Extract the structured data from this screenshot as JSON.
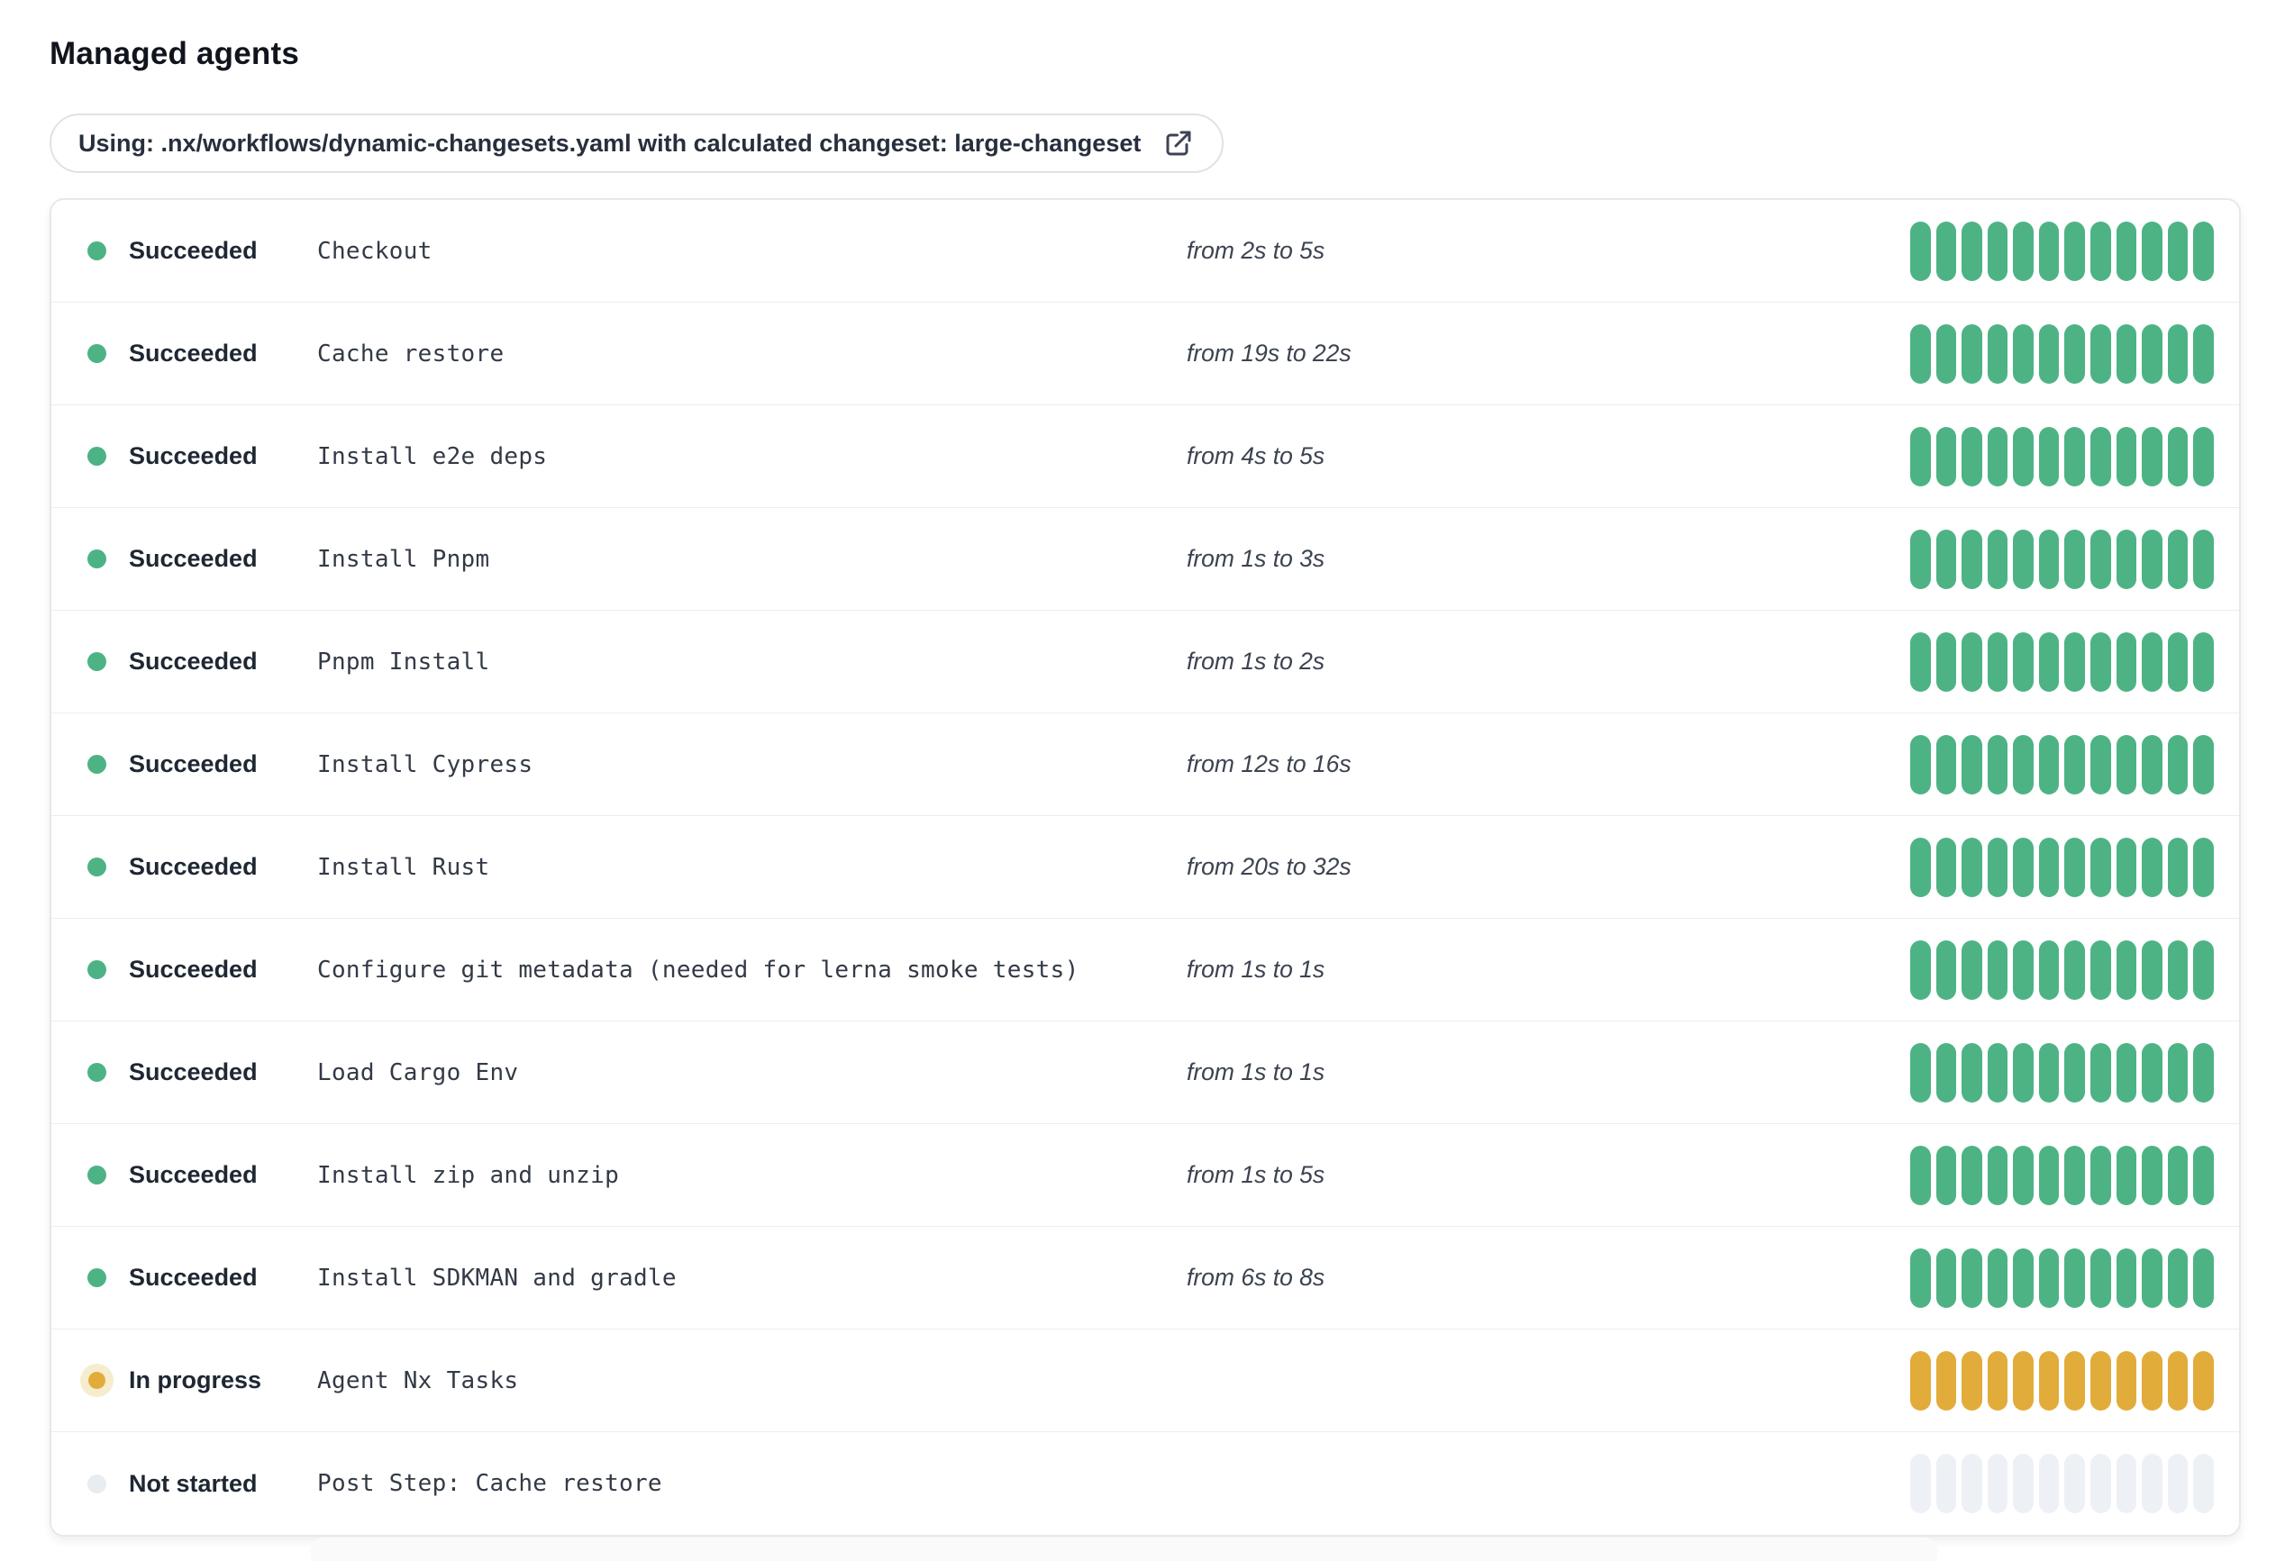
{
  "page": {
    "title": "Managed agents"
  },
  "banner": {
    "label": "Using: .nx/workflows/dynamic-changesets.yaml with calculated changeset: large-changeset",
    "icon": "external-link-icon"
  },
  "colors": {
    "succeeded": "#4DB385",
    "in_progress": "#E2AC3B",
    "in_progress_halo": "#F6EDCF",
    "not_started": "#EDF1F5",
    "not_started_dot": "#E8EDF2",
    "text_primary": "#1F2733",
    "text_mono": "#333A46",
    "card_border": "#E6E8EC",
    "row_divider": "#EBEDF0"
  },
  "progress": {
    "segments_per_row": 12
  },
  "rows": [
    {
      "status": "succeeded",
      "status_label": "Succeeded",
      "name": "Checkout",
      "duration": "from 2s to 5s"
    },
    {
      "status": "succeeded",
      "status_label": "Succeeded",
      "name": "Cache restore",
      "duration": "from 19s to 22s"
    },
    {
      "status": "succeeded",
      "status_label": "Succeeded",
      "name": "Install e2e deps",
      "duration": "from 4s to 5s"
    },
    {
      "status": "succeeded",
      "status_label": "Succeeded",
      "name": "Install Pnpm",
      "duration": "from 1s to 3s"
    },
    {
      "status": "succeeded",
      "status_label": "Succeeded",
      "name": "Pnpm Install",
      "duration": "from 1s to 2s"
    },
    {
      "status": "succeeded",
      "status_label": "Succeeded",
      "name": "Install Cypress",
      "duration": "from 12s to 16s"
    },
    {
      "status": "succeeded",
      "status_label": "Succeeded",
      "name": "Install Rust",
      "duration": "from 20s to 32s"
    },
    {
      "status": "succeeded",
      "status_label": "Succeeded",
      "name": "Configure git metadata (needed for lerna smoke tests)",
      "duration": "from 1s to 1s"
    },
    {
      "status": "succeeded",
      "status_label": "Succeeded",
      "name": "Load Cargo Env",
      "duration": "from 1s to 1s"
    },
    {
      "status": "succeeded",
      "status_label": "Succeeded",
      "name": "Install zip and unzip",
      "duration": "from 1s to 5s"
    },
    {
      "status": "succeeded",
      "status_label": "Succeeded",
      "name": "Install SDKMAN and gradle",
      "duration": "from 6s to 8s"
    },
    {
      "status": "in-progress",
      "status_label": "In progress",
      "name": "Agent Nx Tasks"
    },
    {
      "status": "not-started",
      "status_label": "Not started",
      "name": "Post Step: Cache restore"
    }
  ]
}
